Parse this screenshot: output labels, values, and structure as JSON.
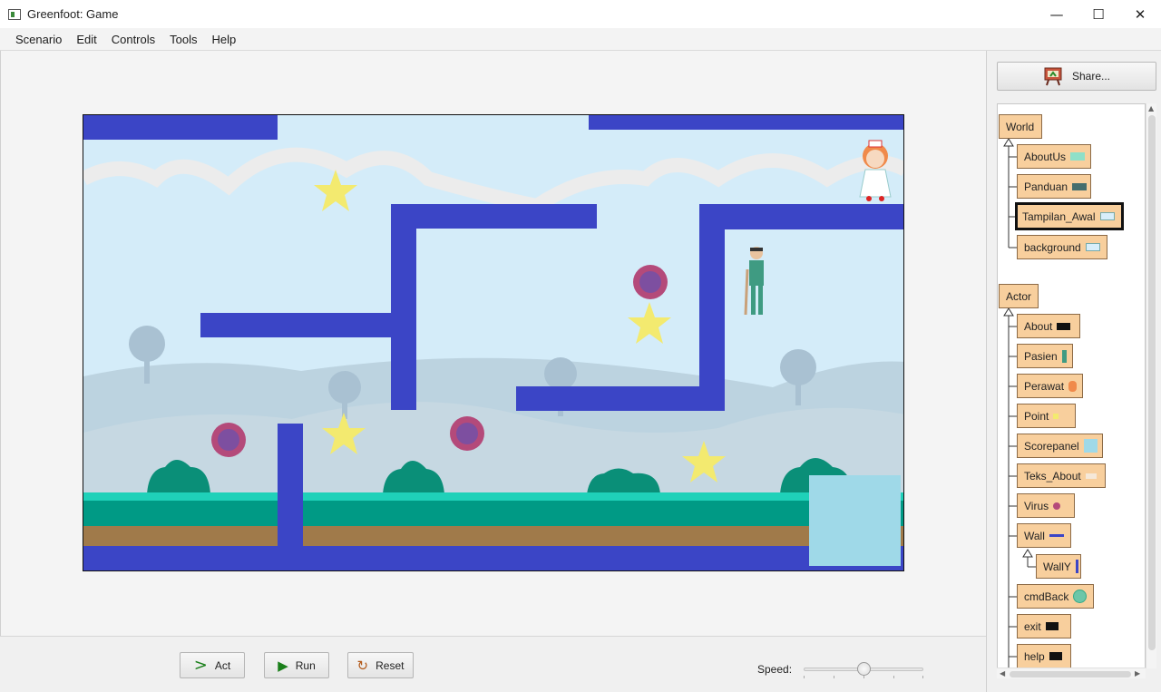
{
  "window": {
    "title": "Greenfoot: Game",
    "minimize": "—",
    "maximize": "☐",
    "close": "✕"
  },
  "menu": [
    "Scenario",
    "Edit",
    "Controls",
    "Tools",
    "Help"
  ],
  "controls": {
    "act_label": "Act",
    "run_label": "Run",
    "reset_label": "Reset",
    "speed_label": "Speed:",
    "speed_value": 0.5
  },
  "share": {
    "label": "Share..."
  },
  "class_tree": {
    "world_root": "World",
    "world_subclasses": [
      "AboutUs",
      "Panduan",
      "Tampilan_Awal",
      "background"
    ],
    "actor_root": "Actor",
    "actor_subclasses": [
      "About",
      "Pasien",
      "Perawat",
      "Point",
      "Scorepanel",
      "Teks_About",
      "Virus",
      "Wall",
      "WallY",
      "cmdBack",
      "exit",
      "help"
    ],
    "selected": "Tampilan_Awal"
  },
  "colors": {
    "wall": "#3b45c6",
    "sky": "#d4ecf9",
    "star": "#f3ea6f",
    "grass": "#009a85",
    "dirt": "#a07a4a",
    "class_box": "#f8cf9d"
  }
}
